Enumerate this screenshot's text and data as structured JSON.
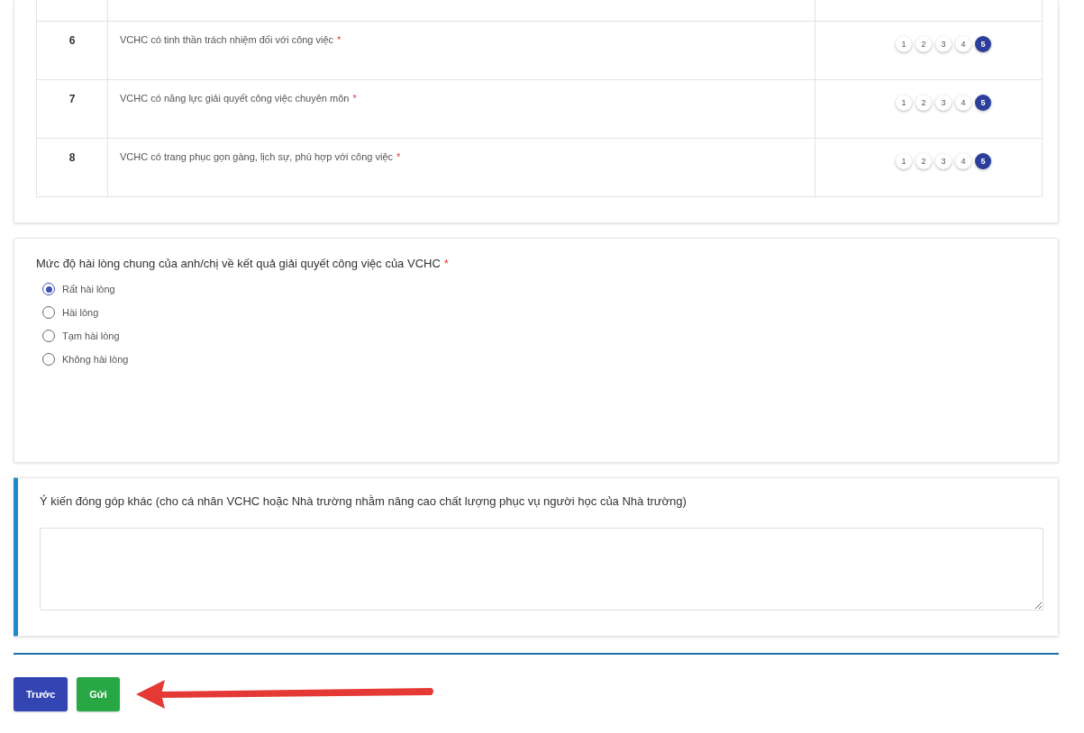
{
  "criteria_table": {
    "rows": [
      {
        "number": "6",
        "question": "VCHC có tinh thần trách nhiệm đối với công việc",
        "required_mark": "*",
        "ratings": [
          {
            "label": "1",
            "selected": false
          },
          {
            "label": "2",
            "selected": false
          },
          {
            "label": "3",
            "selected": false
          },
          {
            "label": "4",
            "selected": false
          },
          {
            "label": "5",
            "selected": true
          }
        ]
      },
      {
        "number": "7",
        "question": "VCHC có năng lực giải quyết công việc chuyên môn",
        "required_mark": "*",
        "ratings": [
          {
            "label": "1",
            "selected": false
          },
          {
            "label": "2",
            "selected": false
          },
          {
            "label": "3",
            "selected": false
          },
          {
            "label": "4",
            "selected": false
          },
          {
            "label": "5",
            "selected": true
          }
        ]
      },
      {
        "number": "8",
        "question": "VCHC có trang phục gọn gàng, lịch sự, phù hợp với công việc",
        "required_mark": "*",
        "ratings": [
          {
            "label": "1",
            "selected": false
          },
          {
            "label": "2",
            "selected": false
          },
          {
            "label": "3",
            "selected": false
          },
          {
            "label": "4",
            "selected": false
          },
          {
            "label": "5",
            "selected": true
          }
        ]
      }
    ]
  },
  "satisfaction": {
    "question": "Mức độ hài lòng chung của anh/chị về kết quả giải quyết công việc của VCHC",
    "required_mark": "*",
    "options": [
      {
        "label": "Rất hài lòng",
        "selected": true
      },
      {
        "label": "Hài lòng",
        "selected": false
      },
      {
        "label": "Tạm hài lòng",
        "selected": false
      },
      {
        "label": "Không hài lòng",
        "selected": false
      }
    ]
  },
  "feedback": {
    "question": "Ý kiến đóng góp khác (cho cá nhân VCHC hoặc Nhà trường nhằm nâng cao chất lượng phục vụ người học của Nhà trường)",
    "focused": true
  },
  "buttons": [
    {
      "label": "Trước",
      "kind": "previous"
    },
    {
      "label": "Gửi",
      "kind": "submit"
    }
  ]
}
